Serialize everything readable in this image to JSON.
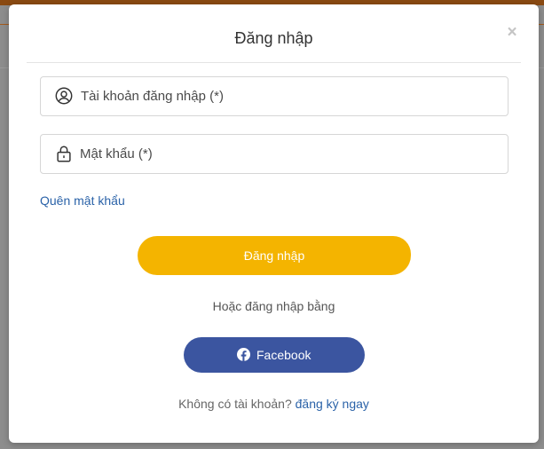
{
  "modal": {
    "title": "Đăng nhập",
    "close_label": "×"
  },
  "form": {
    "username_placeholder": "Tài khoản đăng nhập (*)",
    "password_placeholder": "Mật khẩu (*)",
    "forgot_password": "Quên mật khẩu",
    "login_button": "Đăng nhập"
  },
  "social": {
    "or_text": "Hoặc đăng nhập bằng",
    "facebook_button": "Facebook"
  },
  "signup": {
    "prompt": "Không có tài khoản?",
    "link": "đăng ký ngay"
  },
  "colors": {
    "primary_button": "#f4b400",
    "facebook_button": "#3b55a0",
    "link": "#2a62a8"
  },
  "icons": {
    "username": "user-circle-icon",
    "password": "lock-icon",
    "facebook": "facebook-icon",
    "close": "close-icon"
  }
}
